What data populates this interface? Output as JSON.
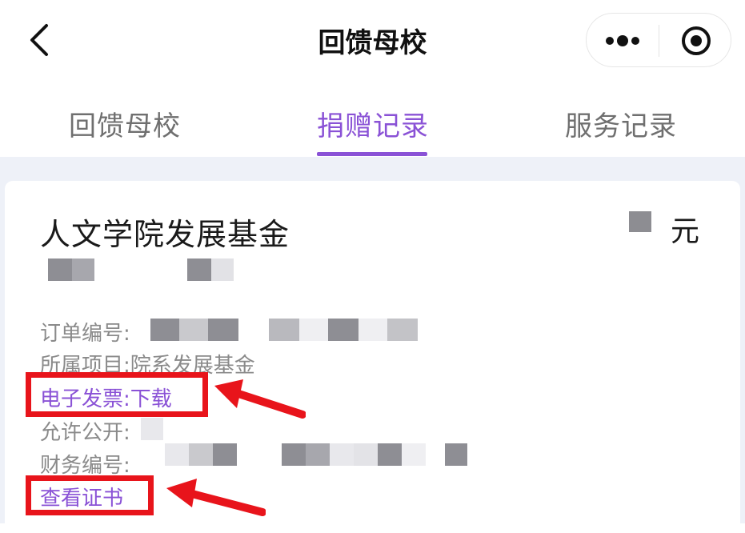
{
  "nav": {
    "title": "回馈母校"
  },
  "tabs": [
    {
      "label": "回馈母校",
      "active": false
    },
    {
      "label": "捐赠记录",
      "active": true
    },
    {
      "label": "服务记录",
      "active": false
    }
  ],
  "record": {
    "fund_name": "人文学院发展基金",
    "amount_unit": "元",
    "order_no_label": "订单编号:",
    "project_label": "所属项目:",
    "project_value": "院系发展基金",
    "invoice_label": "电子发票:",
    "invoice_action": "下载",
    "public_label": "允许公开:",
    "finance_no_label": "财务编号:",
    "certificate_link": "查看证书"
  },
  "colors": {
    "accent": "#8a52d6",
    "annotation": "#e8141b",
    "page_bg": "#eef1f8"
  },
  "icons": {
    "back": "chevron-left-icon",
    "more": "more-dots-icon",
    "target": "record-target-icon",
    "annotation": "red-arrow-icon"
  }
}
